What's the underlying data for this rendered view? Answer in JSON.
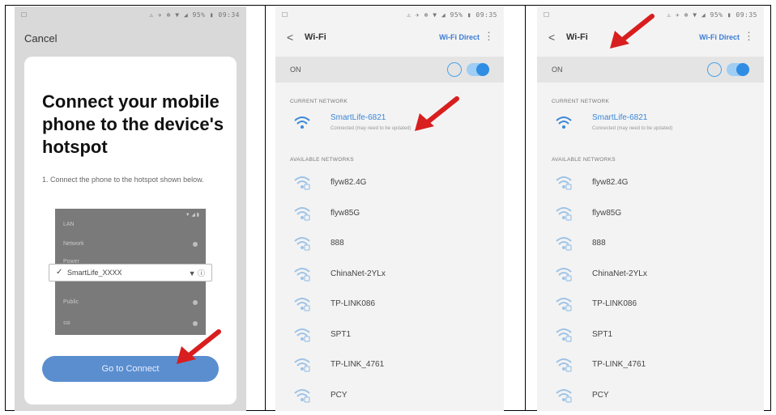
{
  "panel1": {
    "status_left": "☐",
    "status_right": "⚠ ✈ ⊛ ▼ ◢ 95% ▮ 09:34",
    "cancel_label": "Cancel",
    "heading": "Connect your mobile phone to the device's hotspot",
    "step_text": "1. Connect the phone to the hotspot shown below.",
    "mini_rows": [
      "LAN",
      "Network",
      "Power",
      "Public",
      "ssi"
    ],
    "highlight_label": "SmartLife_XXXX",
    "highlight_check": "✓",
    "highlight_icons": "▼ ⓘ",
    "connect_button_label": "Go to Connect"
  },
  "wifi_screens": [
    {
      "status_left": "☐",
      "status_right": "⚠ ✈ ⊛ ▼ ◢ 95% ▮ 09:35",
      "back_icon": "arrow-left-icon",
      "title": "Wi-Fi",
      "direct_label": "Wi-Fi Direct",
      "more_icon": "more-vert-icon",
      "on_label": "ON",
      "connected_header": "CURRENT NETWORK",
      "connected_network": {
        "name": "SmartLife-6821",
        "status": "Connected (may need to be updated)"
      },
      "available_header": "AVAILABLE NETWORKS",
      "networks": [
        "flyw82.4G",
        "flyw85G",
        "888",
        "ChinaNet-2YLx",
        "TP-LINK086",
        "SPT1",
        "TP-LINK_4761",
        "PCY"
      ]
    },
    {
      "status_left": "☐",
      "status_right": "⚠ ✈ ⊛ ▼ ◢ 95% ▮ 09:35",
      "back_icon": "arrow-left-icon",
      "title": "Wi-Fi",
      "direct_label": "Wi-Fi Direct",
      "more_icon": "more-vert-icon",
      "on_label": "ON",
      "connected_header": "CURRENT NETWORK",
      "connected_network": {
        "name": "SmartLife-6821",
        "status": "Connected (may need to be updated)"
      },
      "available_header": "AVAILABLE NETWORKS",
      "networks": [
        "flyw82.4G",
        "flyw85G",
        "888",
        "ChinaNet-2YLx",
        "TP-LINK086",
        "SPT1",
        "TP-LINK_4761",
        "PCY"
      ]
    }
  ],
  "colors": {
    "accent": "#3a87d8",
    "button": "#5b8ecf",
    "arrow": "#d81e1e"
  }
}
